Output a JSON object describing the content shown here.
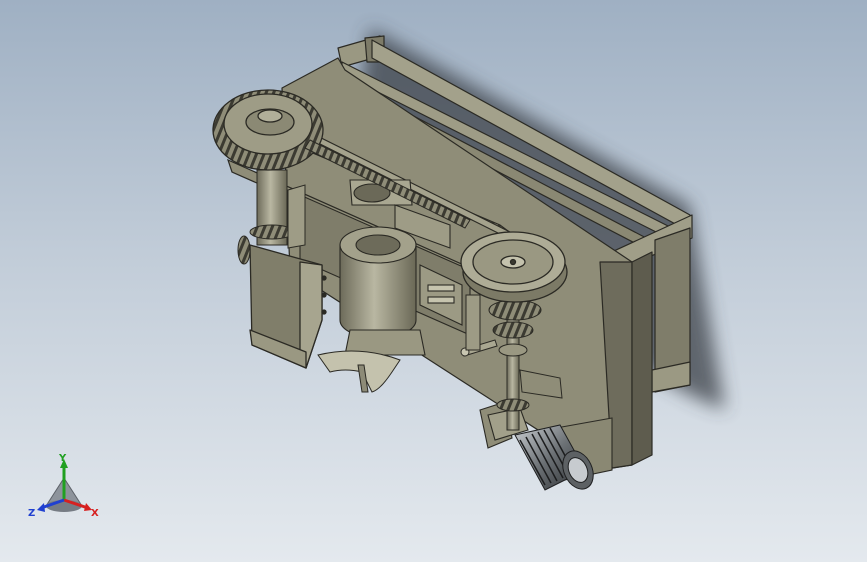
{
  "viewport": {
    "background_top": "#9fb0c3",
    "background_bottom": "#e4e9ee",
    "model_color": "#8f8d78",
    "model_shadow_color": "#3a3f46"
  },
  "triad": {
    "x_label": "X",
    "y_label": "Y",
    "z_label": "Z",
    "x_color": "#d62020",
    "y_color": "#20a020",
    "z_color": "#2040d0"
  }
}
